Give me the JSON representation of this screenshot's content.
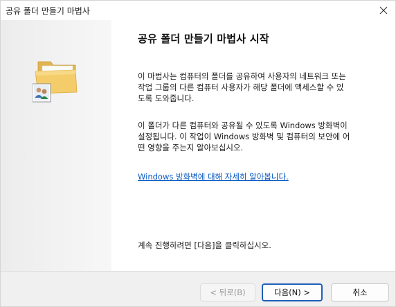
{
  "window": {
    "title": "공유 폴더 만들기 마법사",
    "close_icon": "close-icon"
  },
  "sidebar": {
    "icon": "shared-folder-icon",
    "colors": {
      "folder": "#f2c962",
      "folder_dark": "#d9a93a",
      "users_badge": "#3a6fb0"
    }
  },
  "main": {
    "heading": "공유 폴더 만들기 마법사 시작",
    "paragraph1_line1": "이 마법사는 컴퓨터의 폴더를 공유하여 사용자의 네트워크 또는",
    "paragraph1_line2": "작업 그룹의 다른 컴퓨터 사용자가 해당 폴더에 액세스할 수 있",
    "paragraph1_line3": "도록 도와줍니다.",
    "paragraph2_line1": "이 폴더가 다른 컴퓨터와 공유될 수 있도록 Windows 방화벽이",
    "paragraph2_line2": "설정됩니다. 이 작업이 Windows 방화벽 및 컴퓨터의 보안에 어",
    "paragraph2_line3": "떤 영향을 주는지 알아보십시오.",
    "link": "Windows 방화벽에 대해 자세히 알아봅니다.",
    "continue_text": "계속 진행하려면 [다음]을 클릭하십시오."
  },
  "footer": {
    "back_label": "< 뒤로(B)",
    "next_label": "다음(N) >",
    "cancel_label": "취소"
  },
  "colors": {
    "link": "#0a5bc4",
    "primary_button_border": "#1f5fb8",
    "footer_bg": "#f0f0f0",
    "sidebar_bg": "#ececec"
  }
}
